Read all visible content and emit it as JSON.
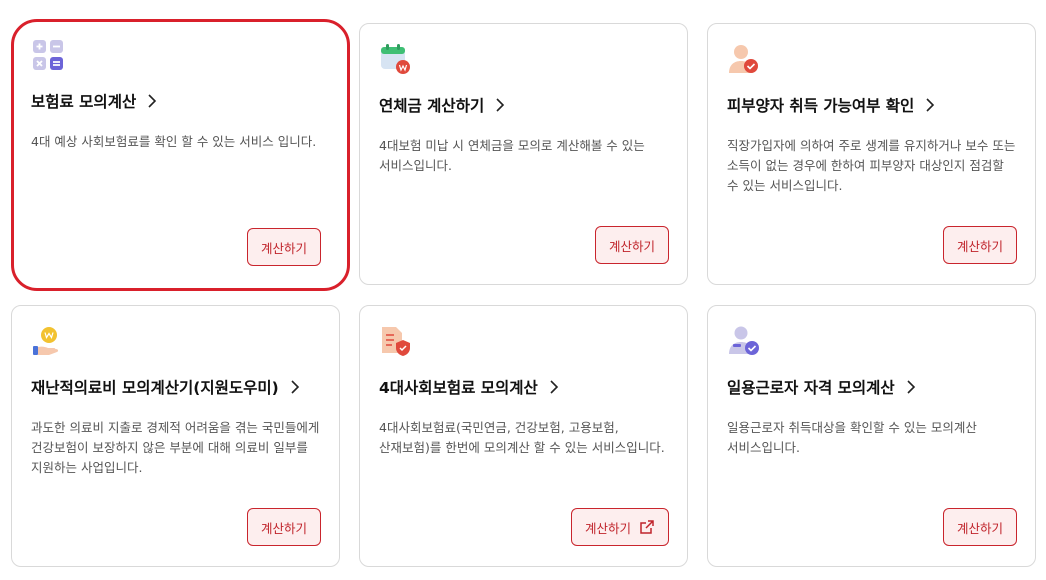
{
  "cards": [
    {
      "title": "보험료 모의계산",
      "desc": "4대 예상 사회보험료를 확인 할 수 있는 서비스 입니다.",
      "button": "계산하기"
    },
    {
      "title": "연체금 계산하기",
      "desc": "4대보험 미납 시 연체금을 모의로 계산해볼 수 있는 서비스입니다.",
      "button": "계산하기"
    },
    {
      "title": "피부양자 취득 가능여부 확인",
      "desc": "직장가입자에 의하여 주로 생계를 유지하거나 보수 또는 소득이 없는 경우에 한하여 피부양자 대상인지 점검할 수 있는 서비스입니다.",
      "button": "계산하기"
    },
    {
      "title": "재난적의료비 모의계산기(지원도우미)",
      "desc": "과도한 의료비 지출로 경제적 어려움을 겪는 국민들에게 건강보험이 보장하지 않은 부분에 대해 의료비 일부를 지원하는 사업입니다.",
      "button": "계산하기"
    },
    {
      "title": "4대사회보험료 모의계산",
      "desc": "4대사회보험료(국민연금, 건강보험, 고용보험, 산재보험)를 한번에 모의계산 할 수 있는 서비스입니다.",
      "button": "계산하기"
    },
    {
      "title": "일용근로자 자격 모의계산",
      "desc": "일용근로자 취득대상을 확인할 수 있는 모의계산 서비스입니다.",
      "button": "계산하기"
    }
  ],
  "icons": [
    "calculator-icon",
    "calendar-won-icon",
    "person-check-icon",
    "hand-coin-icon",
    "document-shield-icon",
    "worker-check-icon"
  ],
  "colors": {
    "accent": "#d9202b",
    "button_bg": "#fdeeee",
    "border": "#d9d9d9"
  }
}
